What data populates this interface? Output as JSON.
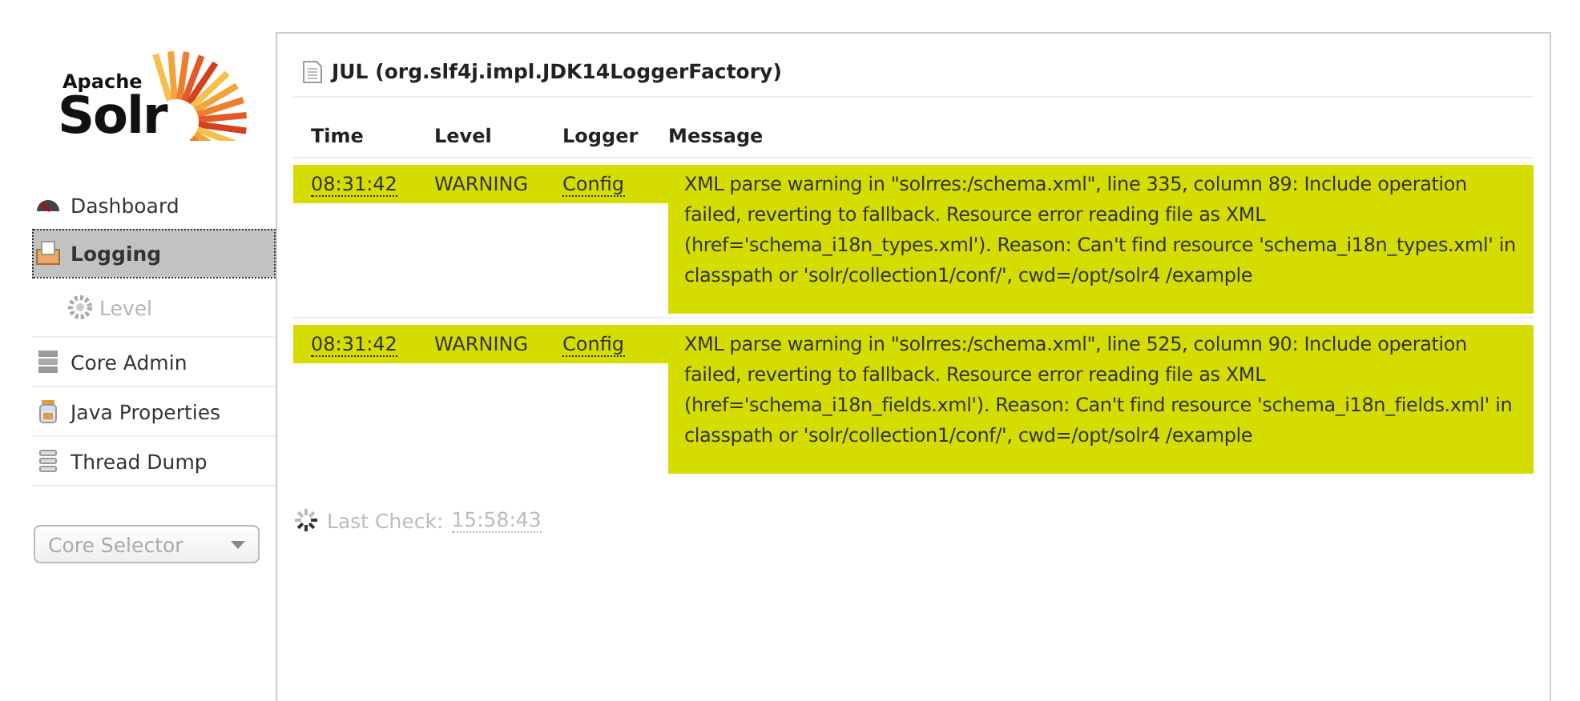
{
  "logo": {
    "top": "Apache",
    "name": "Solr"
  },
  "nav": [
    {
      "label": "Dashboard",
      "selected": false
    },
    {
      "label": "Logging",
      "selected": true,
      "children": [
        {
          "label": "Level",
          "disabled": true
        }
      ]
    },
    {
      "label": "Core Admin",
      "selected": false
    },
    {
      "label": "Java Properties",
      "selected": false
    },
    {
      "label": "Thread Dump",
      "selected": false
    }
  ],
  "core_selector": {
    "value": "Core Selector"
  },
  "panel": {
    "title": "JUL (org.slf4j.impl.JDK14LoggerFactory)",
    "table": {
      "columns": [
        "Time",
        "Level",
        "Logger",
        "Message"
      ],
      "rows": [
        {
          "time": "08:31:42",
          "level": "WARNING",
          "logger": "Config",
          "message": "XML parse warning in \"solrres:/schema.xml\", line 335, column 89: Include operation failed, reverting to fallback. Resource error reading file as XML (href='schema_i18n_types.xml'). Reason: Can't find resource 'schema_i18n_types.xml' in classpath or 'solr/collection1/conf/', cwd=/opt/solr4 /example"
        },
        {
          "time": "08:31:42",
          "level": "WARNING",
          "logger": "Config",
          "message": "XML parse warning in \"solrres:/schema.xml\", line 525, column 90: Include operation failed, reverting to fallback. Resource error reading file as XML (href='schema_i18n_fields.xml'). Reason: Can't find resource 'schema_i18n_fields.xml' in classpath or 'solr/collection1/conf/', cwd=/opt/solr4 /example"
        }
      ]
    },
    "last_check": {
      "label": "Last Check:",
      "time": "15:58:43"
    }
  }
}
